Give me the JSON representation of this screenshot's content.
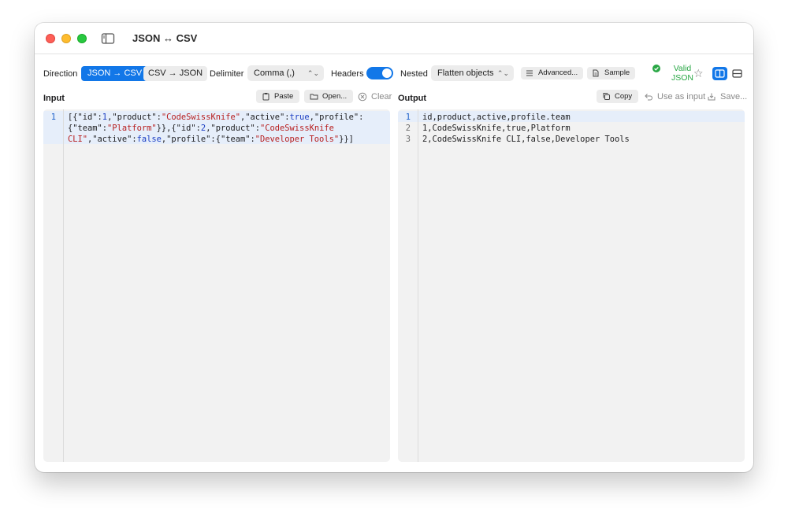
{
  "window": {
    "title": "JSON ↔ CSV"
  },
  "toolbar": {
    "direction_label": "Direction",
    "direction_options": [
      "JSON → CSV",
      "CSV → JSON"
    ],
    "direction_selected": "JSON → CSV",
    "delimiter_label": "Delimiter",
    "delimiter_value": "Comma (,)",
    "headers_label": "Headers",
    "headers_on": true,
    "nested_label": "Nested",
    "nested_value": "Flatten objects",
    "advanced_label": "Advanced...",
    "sample_label": "Sample",
    "validity_line1": "Valid",
    "validity_line2": "JSON"
  },
  "input": {
    "label": "Input",
    "paste_label": "Paste",
    "open_label": "Open...",
    "clear_label": "Clear",
    "line_numbers": [
      "1"
    ],
    "lines": [
      "[{\"id\":1,\"product\":\"CodeSwissKnife\",\"active\":true,\"profile\":",
      "{\"team\":\"Platform\"}},{\"id\":2,\"product\":\"CodeSwissKnife",
      "CLI\",\"active\":false,\"profile\":{\"team\":\"Developer Tools\"}}]"
    ]
  },
  "output": {
    "label": "Output",
    "copy_label": "Copy",
    "use_as_input_label": "Use as input",
    "save_label": "Save...",
    "line_numbers": [
      "1",
      "2",
      "3"
    ],
    "lines": [
      "id,product,active,profile.team",
      "1,CodeSwissKnife,true,Platform",
      "2,CodeSwissKnife CLI,false,Developer Tools"
    ]
  },
  "colors": {
    "accent": "#1277e8",
    "valid": "#29a745",
    "string_token": "#b71c1c",
    "number_token": "#1a3cc2"
  },
  "icons": [
    "sidebar-toggle-icon",
    "list-icon",
    "document-icon",
    "checkmark-circle-icon",
    "star-icon",
    "split-vertical-icon",
    "split-horizontal-icon",
    "clipboard-icon",
    "folder-icon",
    "clear-circle-icon",
    "copy-icon",
    "undo-arrow-icon",
    "save-icon"
  ]
}
